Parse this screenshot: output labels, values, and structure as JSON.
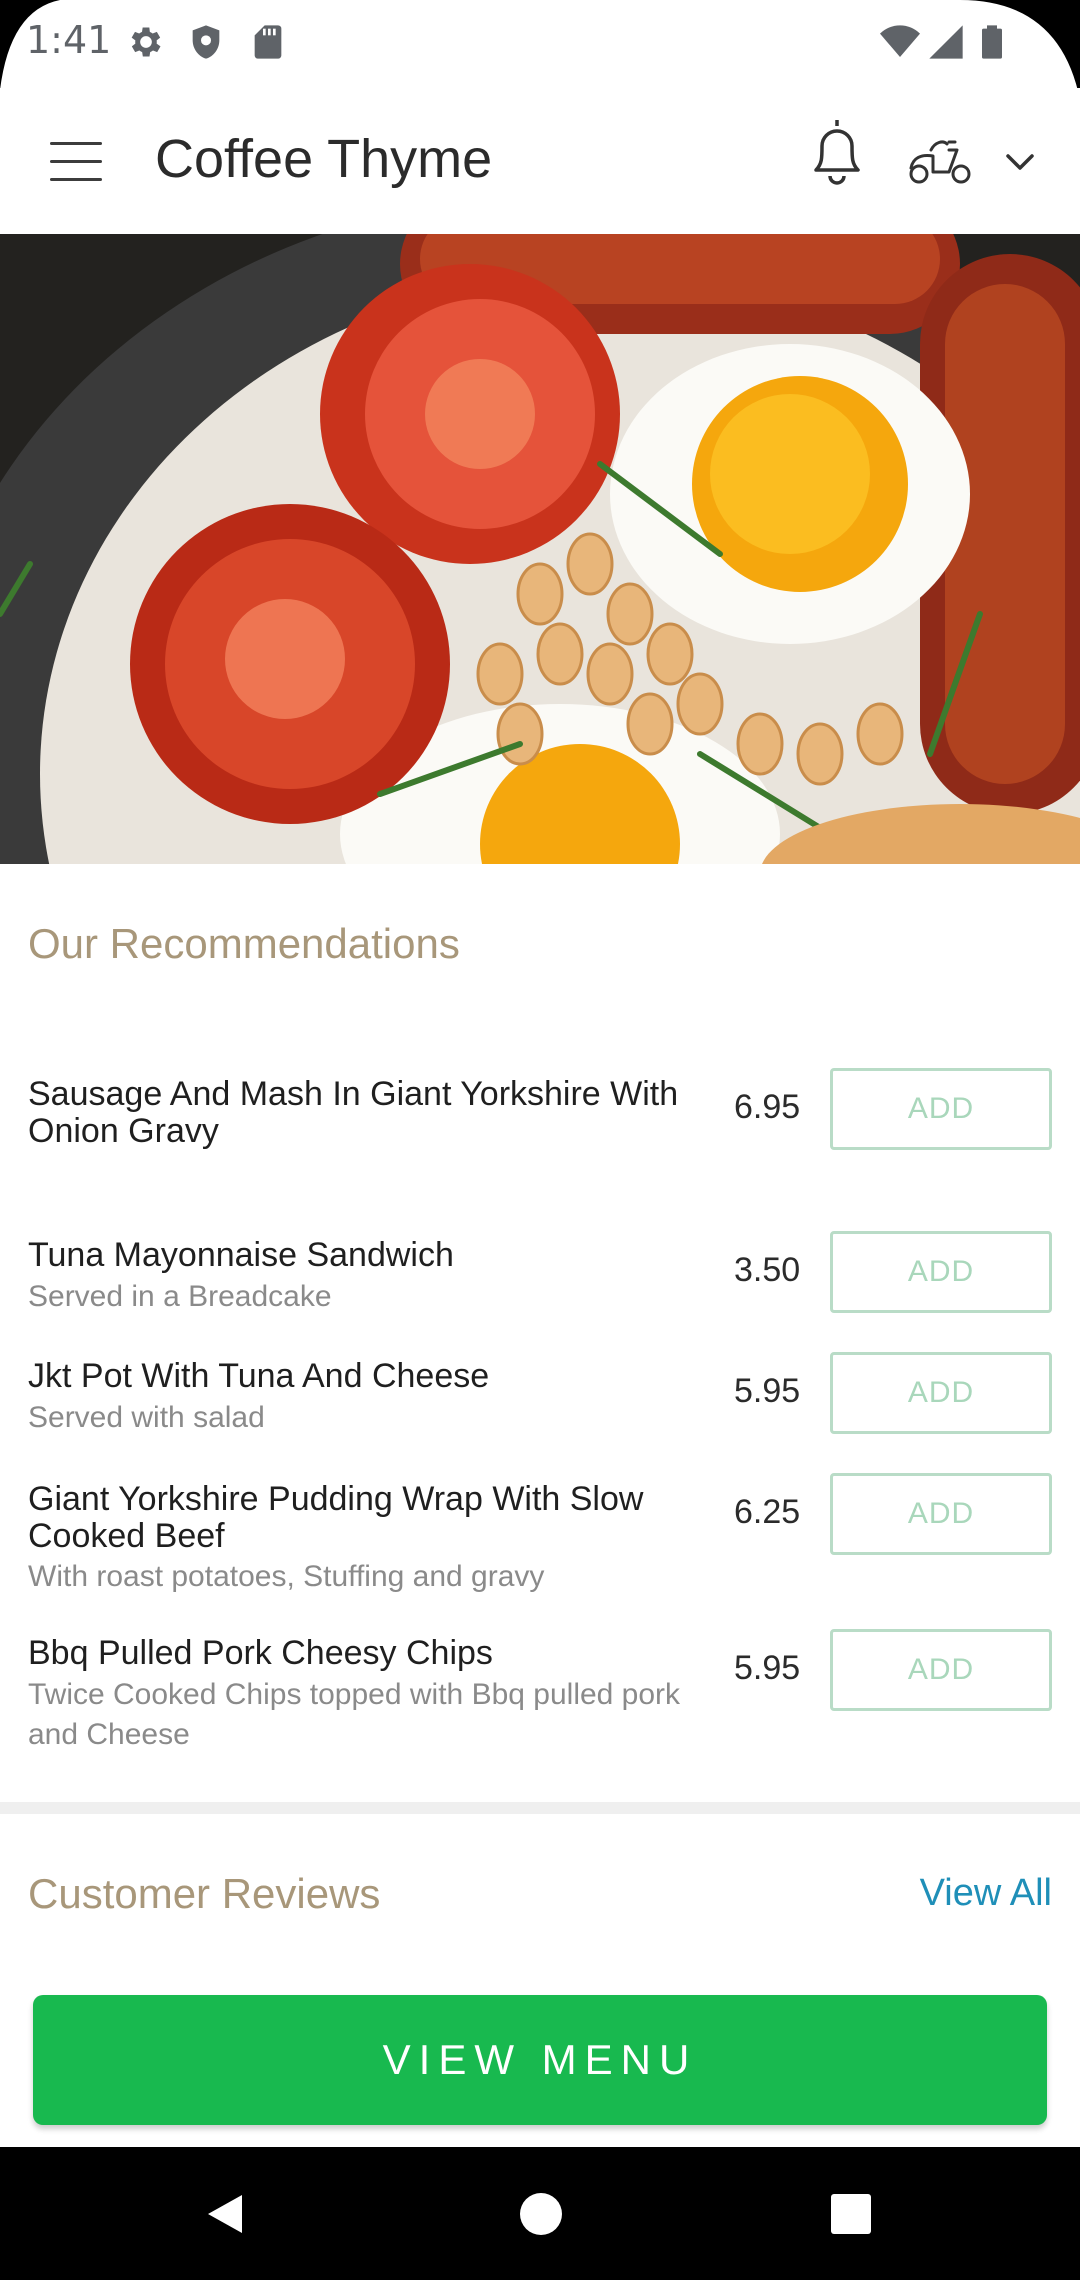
{
  "status_bar": {
    "time": "1:41"
  },
  "app_bar": {
    "title": "Coffee Thyme"
  },
  "recommendations": {
    "title": "Our Recommendations",
    "add_label": "ADD",
    "items": [
      {
        "name": "Sausage And Mash In Giant Yorkshire With Onion Gravy",
        "description": "",
        "price": "6.95"
      },
      {
        "name": "Tuna Mayonnaise Sandwich",
        "description": "Served in a Breadcake",
        "price": "3.50"
      },
      {
        "name": "Jkt Pot With Tuna And Cheese",
        "description": "Served with salad",
        "price": "5.95"
      },
      {
        "name": "Giant Yorkshire Pudding Wrap With Slow Cooked Beef",
        "description": "With roast potatoes, Stuffing and gravy",
        "price": "6.25"
      },
      {
        "name": "Bbq Pulled Pork Cheesy Chips",
        "description": "Twice Cooked Chips topped with Bbq pulled pork and Cheese",
        "price": "5.95"
      }
    ]
  },
  "reviews": {
    "title": "Customer Reviews",
    "view_all": "View All"
  },
  "view_menu_button": "VIEW MENU",
  "colors": {
    "accent_green": "#18b94f",
    "section_title": "#a8977a",
    "link_blue": "#1f8fb8"
  },
  "icons": {
    "status": [
      "gear-icon",
      "shield-icon",
      "sd-card-icon",
      "wifi-icon",
      "signal-icon",
      "battery-icon"
    ],
    "app_bar": [
      "hamburger-menu-icon",
      "bell-icon",
      "scooter-icon",
      "chevron-down-icon"
    ],
    "nav": [
      "back-icon",
      "home-icon",
      "recents-icon"
    ]
  }
}
